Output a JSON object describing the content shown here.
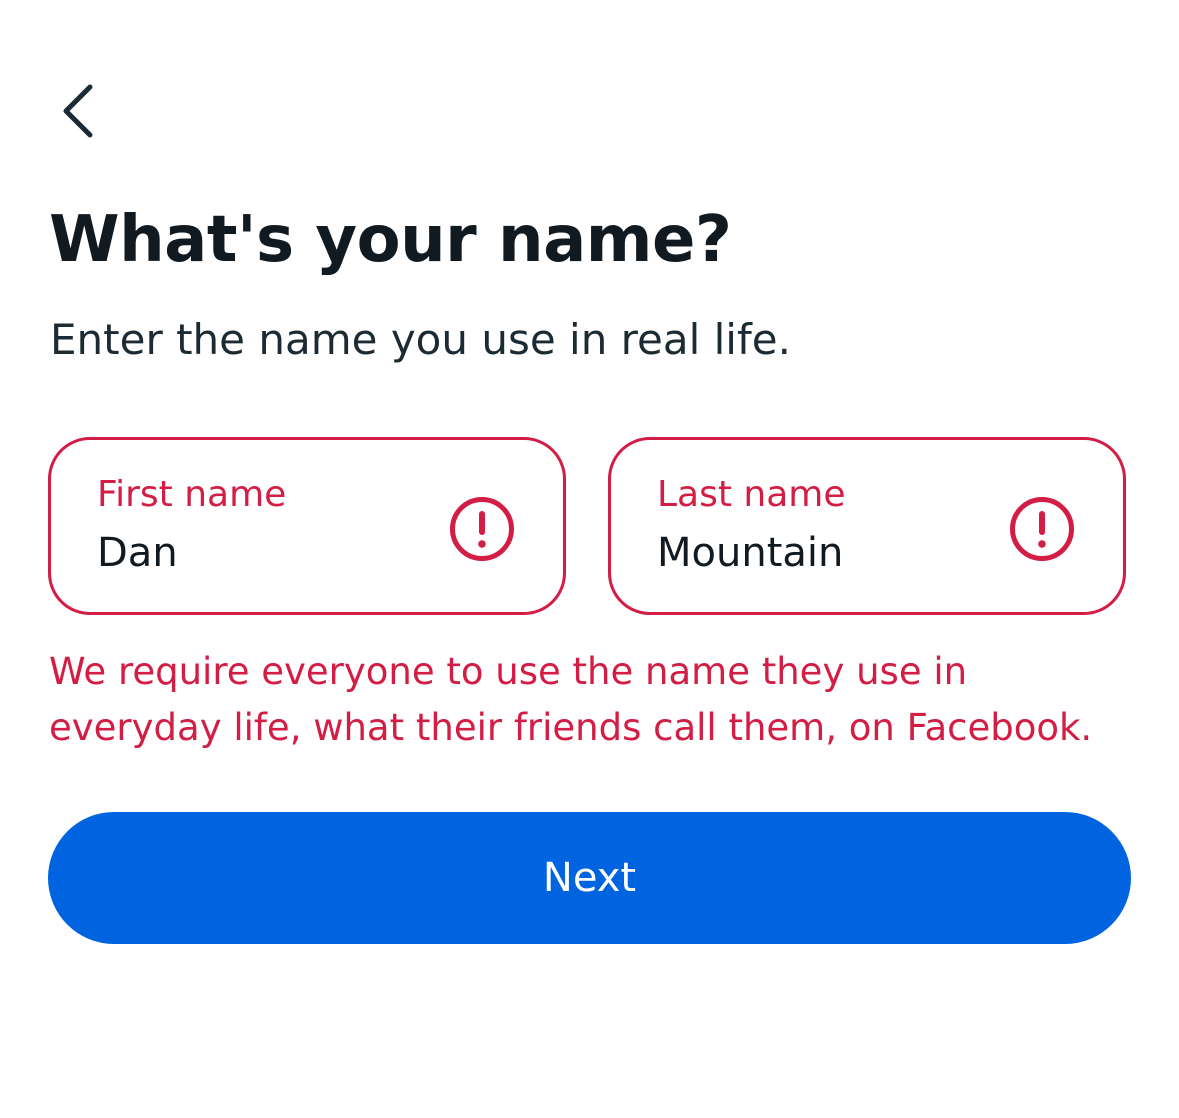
{
  "nav": {
    "back_icon": "chevron-left-icon"
  },
  "header": {
    "title": "What's your name?",
    "subtitle": "Enter the name you use in real life."
  },
  "form": {
    "first_name": {
      "label": "First name",
      "value": "Dan",
      "status_icon": "error-exclamation-icon"
    },
    "last_name": {
      "label": "Last name",
      "value": "Mountain",
      "status_icon": "error-exclamation-icon"
    },
    "error_message": "We require everyone to use the name they use in everyday life, what their friends call them, on Facebook."
  },
  "actions": {
    "next_label": "Next"
  },
  "colors": {
    "error": "#d31d44",
    "primary": "#0064e0",
    "text": "#1c2b33",
    "background": "#ffffff"
  }
}
